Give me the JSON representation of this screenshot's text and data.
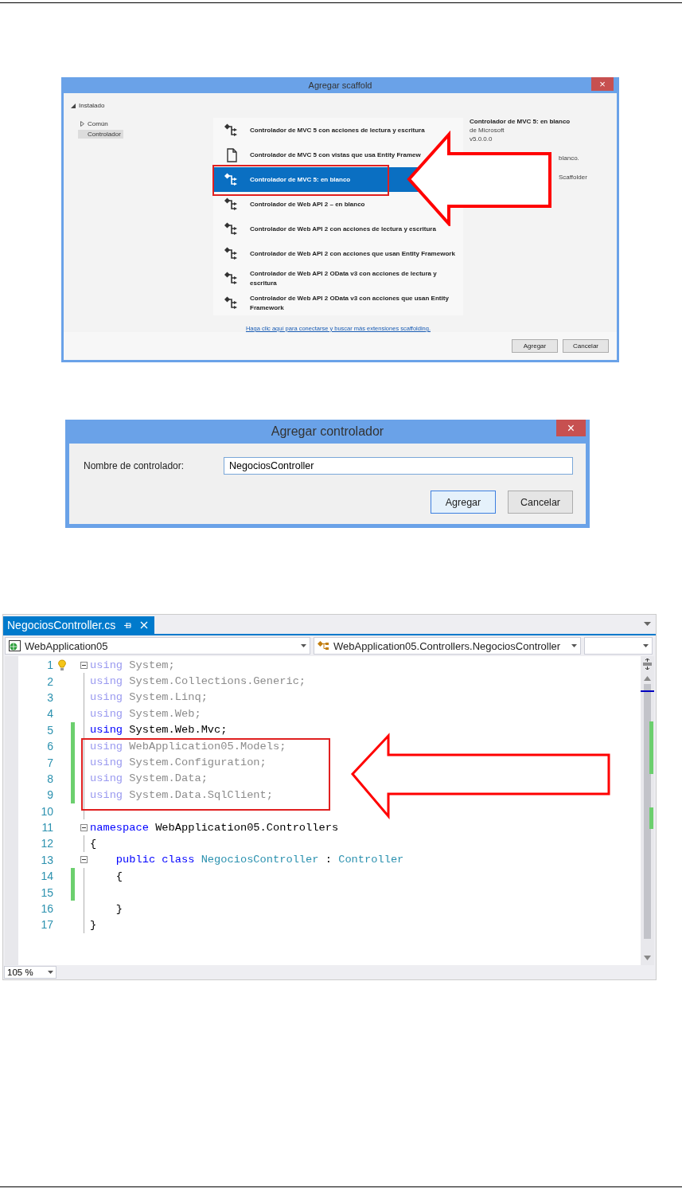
{
  "scaffold_dialog": {
    "title": "Agregar scaffold",
    "close": "×",
    "tree": [
      {
        "label": "Instalado",
        "expanded": true,
        "selected": false,
        "children": [
          {
            "label": "Común",
            "expanded": false,
            "selected": false
          },
          {
            "label": "Controlador",
            "selected": true
          }
        ]
      }
    ],
    "items": [
      {
        "label": "Controlador de MVC 5 con acciones de lectura y escritura",
        "kind": "controller",
        "selected": false
      },
      {
        "label": "Controlador de MVC 5 con vistas que usa Entity Framew",
        "kind": "view",
        "selected": false
      },
      {
        "label": "Controlador de MVC 5: en blanco",
        "kind": "controller",
        "selected": true
      },
      {
        "label": "Controlador de Web API 2 – en blanco",
        "kind": "controller",
        "selected": false
      },
      {
        "label": "Controlador de Web API 2 con acciones de lectura y escritura",
        "kind": "controller",
        "selected": false
      },
      {
        "label": "Controlador de Web API 2 con acciones que usan Entity Framework",
        "kind": "controller",
        "selected": false
      },
      {
        "label": "Controlador de Web API 2 OData v3 con acciones de lectura y escritura",
        "kind": "controller",
        "selected": false
      },
      {
        "label": "Controlador de Web API 2 OData v3 con acciones que usan Entity Framework",
        "kind": "controller",
        "selected": false
      }
    ],
    "details": [
      {
        "text": "Controlador de MVC 5: en blanco",
        "kind": "title"
      },
      {
        "text": "de Microsoft",
        "kind": "line"
      },
      {
        "text": "v5.0.0.0",
        "kind": "line"
      },
      {
        "text": "blanco.",
        "kind": "fragment"
      },
      {
        "text": "Scaffolder",
        "kind": "fragment"
      }
    ],
    "link": "Haga clic aquí para conectarse y buscar más extensiones scaffolding.",
    "buttons": [
      {
        "label": "Agregar",
        "focused": false
      },
      {
        "label": "Cancelar",
        "focused": false
      }
    ]
  },
  "controller_dialog": {
    "title": "Agregar controlador",
    "close": "×",
    "field_label": "Nombre de controlador:",
    "value": "NegociosController",
    "buttons": [
      {
        "label": "Agregar",
        "focused": true
      },
      {
        "label": "Cancelar",
        "focused": false
      }
    ]
  },
  "editor": {
    "tab": {
      "label": "NegociosController.cs",
      "selected": true
    },
    "project_dropdown": "WebApplication05",
    "class_dropdown": "WebApplication05.Controllers.NegociosController",
    "lines": [
      {
        "number": "1",
        "bulb": true,
        "fold": true,
        "changed": false,
        "faded": true,
        "tokens": [
          {
            "text": "using",
            "kind": "keyword"
          },
          {
            "text": " System;",
            "kind": "plain"
          }
        ]
      },
      {
        "number": "2",
        "bulb": false,
        "fold": false,
        "changed": false,
        "faded": true,
        "tokens": [
          {
            "text": "using",
            "kind": "keyword"
          },
          {
            "text": " System.Collections.Generic;",
            "kind": "plain"
          }
        ]
      },
      {
        "number": "3",
        "bulb": false,
        "fold": false,
        "changed": false,
        "faded": true,
        "tokens": [
          {
            "text": "using",
            "kind": "keyword"
          },
          {
            "text": " System.Linq;",
            "kind": "plain"
          }
        ]
      },
      {
        "number": "4",
        "bulb": false,
        "fold": false,
        "changed": false,
        "faded": true,
        "tokens": [
          {
            "text": "using",
            "kind": "keyword"
          },
          {
            "text": " System.Web;",
            "kind": "plain"
          }
        ]
      },
      {
        "number": "5",
        "bulb": false,
        "fold": false,
        "changed": true,
        "faded": false,
        "tokens": [
          {
            "text": "using",
            "kind": "keyword"
          },
          {
            "text": " System.Web.Mvc;",
            "kind": "plain"
          }
        ]
      },
      {
        "number": "6",
        "bulb": false,
        "fold": false,
        "changed": true,
        "faded": true,
        "tokens": [
          {
            "text": "using",
            "kind": "keyword"
          },
          {
            "text": " WebApplication05.Models;",
            "kind": "plain"
          }
        ]
      },
      {
        "number": "7",
        "bulb": false,
        "fold": false,
        "changed": true,
        "faded": true,
        "tokens": [
          {
            "text": "using",
            "kind": "keyword"
          },
          {
            "text": " System.Configuration;",
            "kind": "plain"
          }
        ]
      },
      {
        "number": "8",
        "bulb": false,
        "fold": false,
        "changed": true,
        "faded": true,
        "tokens": [
          {
            "text": "using",
            "kind": "keyword"
          },
          {
            "text": " System.Data;",
            "kind": "plain"
          }
        ]
      },
      {
        "number": "9",
        "bulb": false,
        "fold": false,
        "changed": true,
        "faded": true,
        "tokens": [
          {
            "text": "using",
            "kind": "keyword"
          },
          {
            "text": " System.Data.SqlClient;",
            "kind": "plain"
          }
        ]
      },
      {
        "number": "10",
        "bulb": false,
        "fold": false,
        "changed": false
      },
      {
        "number": "11",
        "bulb": false,
        "fold": true,
        "changed": false,
        "faded": false,
        "tokens": [
          {
            "text": "namespace",
            "kind": "keyword"
          },
          {
            "text": " WebApplication05.Controllers",
            "kind": "plain"
          }
        ]
      },
      {
        "number": "12",
        "bulb": false,
        "fold": false,
        "changed": false,
        "faded": false,
        "tokens": [
          {
            "text": "{",
            "kind": "plain"
          }
        ]
      },
      {
        "number": "13",
        "bulb": false,
        "fold": true,
        "changed": false,
        "faded": false,
        "tokens": [
          {
            "text": "    public",
            "kind": "keyword"
          },
          {
            "text": " class",
            "kind": "keyword"
          },
          {
            "text": " NegociosController",
            "kind": "type"
          },
          {
            "text": " :",
            "kind": "plain"
          },
          {
            "text": " Controller",
            "kind": "type"
          }
        ]
      },
      {
        "number": "14",
        "bulb": false,
        "fold": false,
        "changed": true,
        "faded": false,
        "tokens": [
          {
            "text": "    {",
            "kind": "plain"
          }
        ]
      },
      {
        "number": "15",
        "bulb": false,
        "fold": false,
        "changed": true
      },
      {
        "number": "16",
        "bulb": false,
        "fold": false,
        "changed": false,
        "faded": false,
        "tokens": [
          {
            "text": "    }",
            "kind": "plain"
          }
        ]
      },
      {
        "number": "17",
        "bulb": false,
        "fold": false,
        "changed": false,
        "faded": false,
        "tokens": [
          {
            "text": "}",
            "kind": "plain"
          }
        ]
      }
    ],
    "zoom": "105 %"
  }
}
